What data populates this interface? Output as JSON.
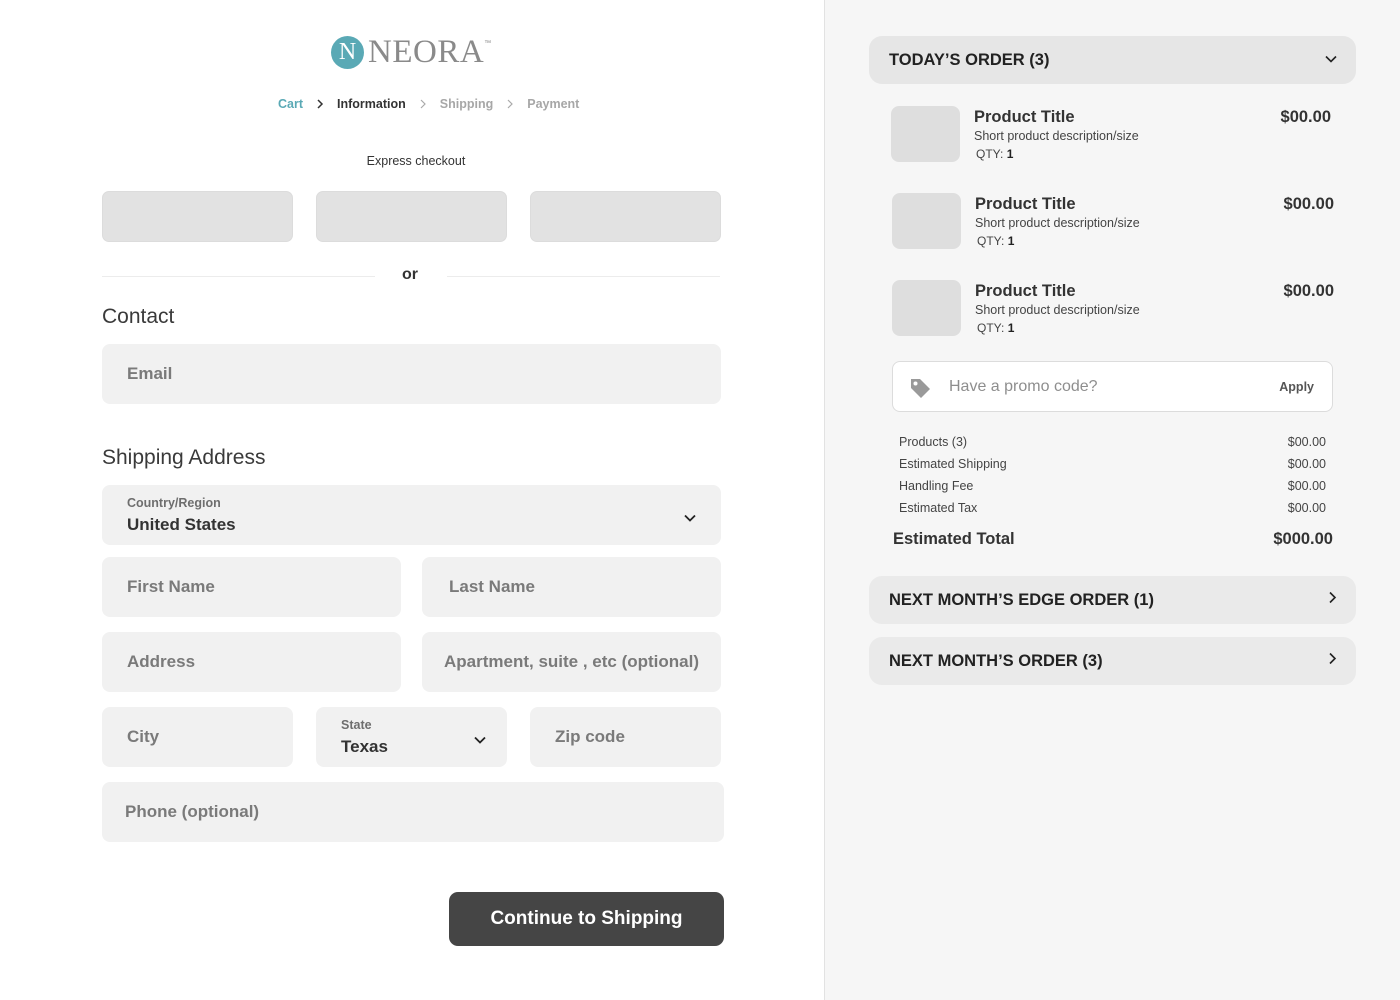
{
  "brand": {
    "mark": "N",
    "name": "NEORA",
    "tm": "™"
  },
  "breadcrumb": [
    "Cart",
    "Information",
    "Shipping",
    "Payment"
  ],
  "express": {
    "label": "Express checkout"
  },
  "divider": {
    "or": "or"
  },
  "contact": {
    "title": "Contact",
    "email_placeholder": "Email"
  },
  "shipping": {
    "title": "Shipping Address",
    "country_label": "Country/Region",
    "country_value": "United States",
    "first_name": "First Name",
    "last_name": "Last Name",
    "address": "Address",
    "apartment": "Apartment, suite , etc (optional)",
    "city": "City",
    "state_label": "State",
    "state_value": "Texas",
    "zip": "Zip code",
    "phone": "Phone (optional)"
  },
  "cta": {
    "label": "Continue to Shipping"
  },
  "order": {
    "today_title": "TODAY’S ORDER (3)",
    "products": [
      {
        "title": "Product Title",
        "desc": "Short product description/size",
        "qty_label": "QTY:",
        "qty": "1",
        "price": "$00.00"
      },
      {
        "title": "Product Title",
        "desc": "Short product description/size",
        "qty_label": "QTY:",
        "qty": "1",
        "price": "$00.00"
      },
      {
        "title": "Product Title",
        "desc": "Short product description/size",
        "qty_label": "QTY:",
        "qty": "1",
        "price": "$00.00"
      }
    ],
    "promo_placeholder": "Have a promo code?",
    "promo_apply": "Apply",
    "summary": [
      {
        "label": "Products (3)",
        "amount": "$00.00"
      },
      {
        "label": "Estimated Shipping",
        "amount": "$00.00"
      },
      {
        "label": "Handling Fee",
        "amount": "$00.00"
      },
      {
        "label": "Estimated Tax",
        "amount": "$00.00"
      }
    ],
    "total_label": "Estimated Total",
    "total_amount": "$000.00",
    "edge_title": "NEXT MONTH’S EDGE ORDER (1)",
    "next_title": "NEXT MONTH’S ORDER (3)"
  },
  "colors": {
    "accent": "#5aa9b5",
    "cta": "#454545",
    "field": "#f1f1f1",
    "panel": "#f6f6f6"
  },
  "icons": [
    "chevron-right-icon",
    "chevron-down-icon",
    "tag-icon"
  ]
}
